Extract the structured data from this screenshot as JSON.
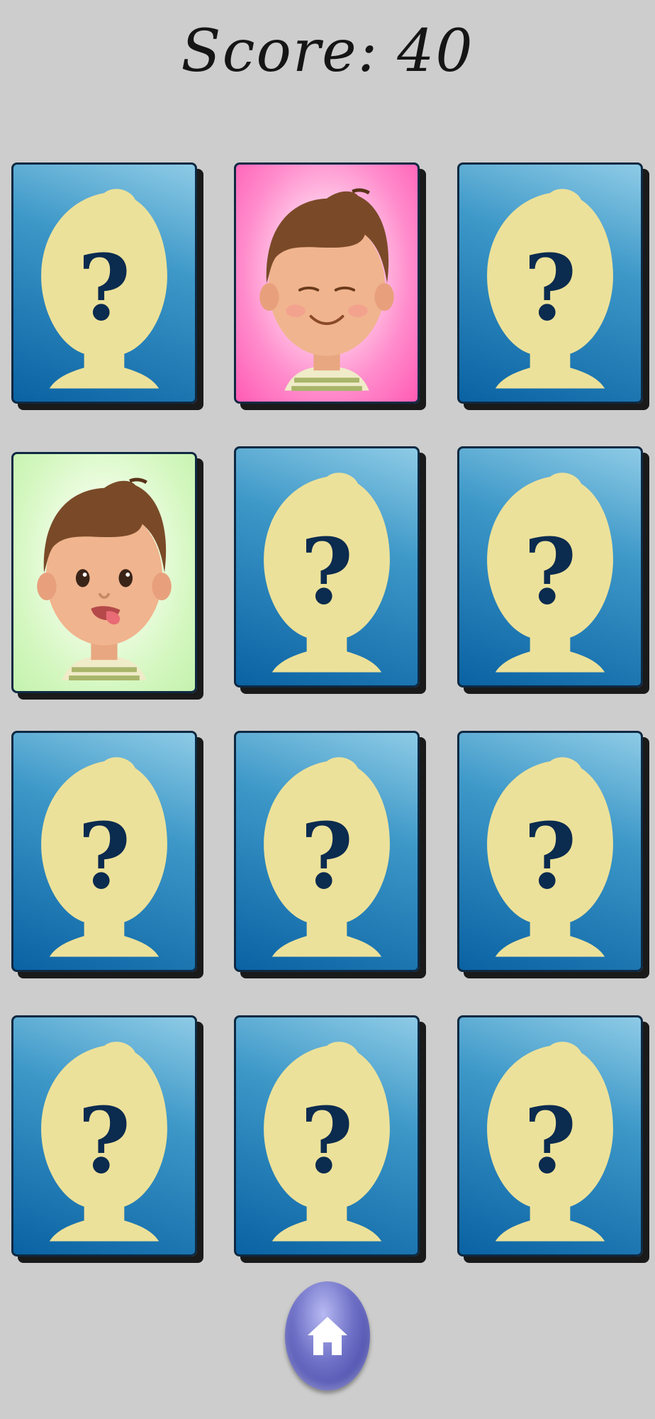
{
  "header": {
    "score_label": "Score:",
    "score_value": "40"
  },
  "board": {
    "cards": [
      {
        "state": "hidden",
        "symbol": "?"
      },
      {
        "state": "revealed",
        "face": "smiling-boy",
        "background": "#ff6ec0"
      },
      {
        "state": "hidden",
        "symbol": "?"
      },
      {
        "state": "revealed",
        "face": "tongue-out-boy",
        "background": "#cdf6b8"
      },
      {
        "state": "hidden",
        "symbol": "?"
      },
      {
        "state": "hidden",
        "symbol": "?"
      },
      {
        "state": "hidden",
        "symbol": "?"
      },
      {
        "state": "hidden",
        "symbol": "?"
      },
      {
        "state": "hidden",
        "symbol": "?"
      },
      {
        "state": "hidden",
        "symbol": "?"
      },
      {
        "state": "hidden",
        "symbol": "?"
      },
      {
        "state": "hidden",
        "symbol": "?"
      }
    ]
  },
  "footer": {
    "home_icon": "home-icon"
  },
  "colors": {
    "card_back": "#1a78b8",
    "silhouette": "#ece19a",
    "question_mark": "#0b2b4f",
    "home_button": "#6f71c7"
  }
}
